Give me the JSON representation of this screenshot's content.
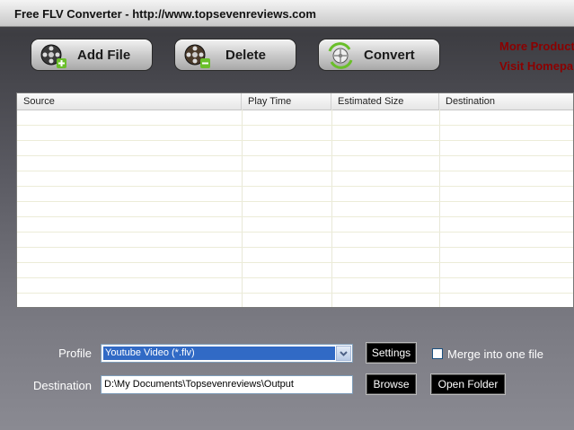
{
  "window": {
    "title": "Free FLV Converter - http://www.topsevenreviews.com"
  },
  "toolbar": {
    "add_file_label": "Add File",
    "delete_label": "Delete",
    "convert_label": "Convert"
  },
  "promo": {
    "more_products": "More Product",
    "visit_homepage": "Visit Homepa"
  },
  "file_list": {
    "columns": [
      "Source",
      "Play Time",
      "Estimated Size",
      "Destination"
    ],
    "rows": []
  },
  "form": {
    "profile_label": "Profile",
    "profile_value": "Youtube Video (*.flv)",
    "destination_label": "Destination",
    "destination_value": "D:\\My Documents\\Topsevenreviews\\Output",
    "settings_label": "Settings",
    "browse_label": "Browse",
    "open_folder_label": "Open Folder",
    "merge_label": "Merge into one file",
    "merge_checked": false
  },
  "colors": {
    "promo_text": "#8b0000",
    "selection": "#316ac5"
  }
}
